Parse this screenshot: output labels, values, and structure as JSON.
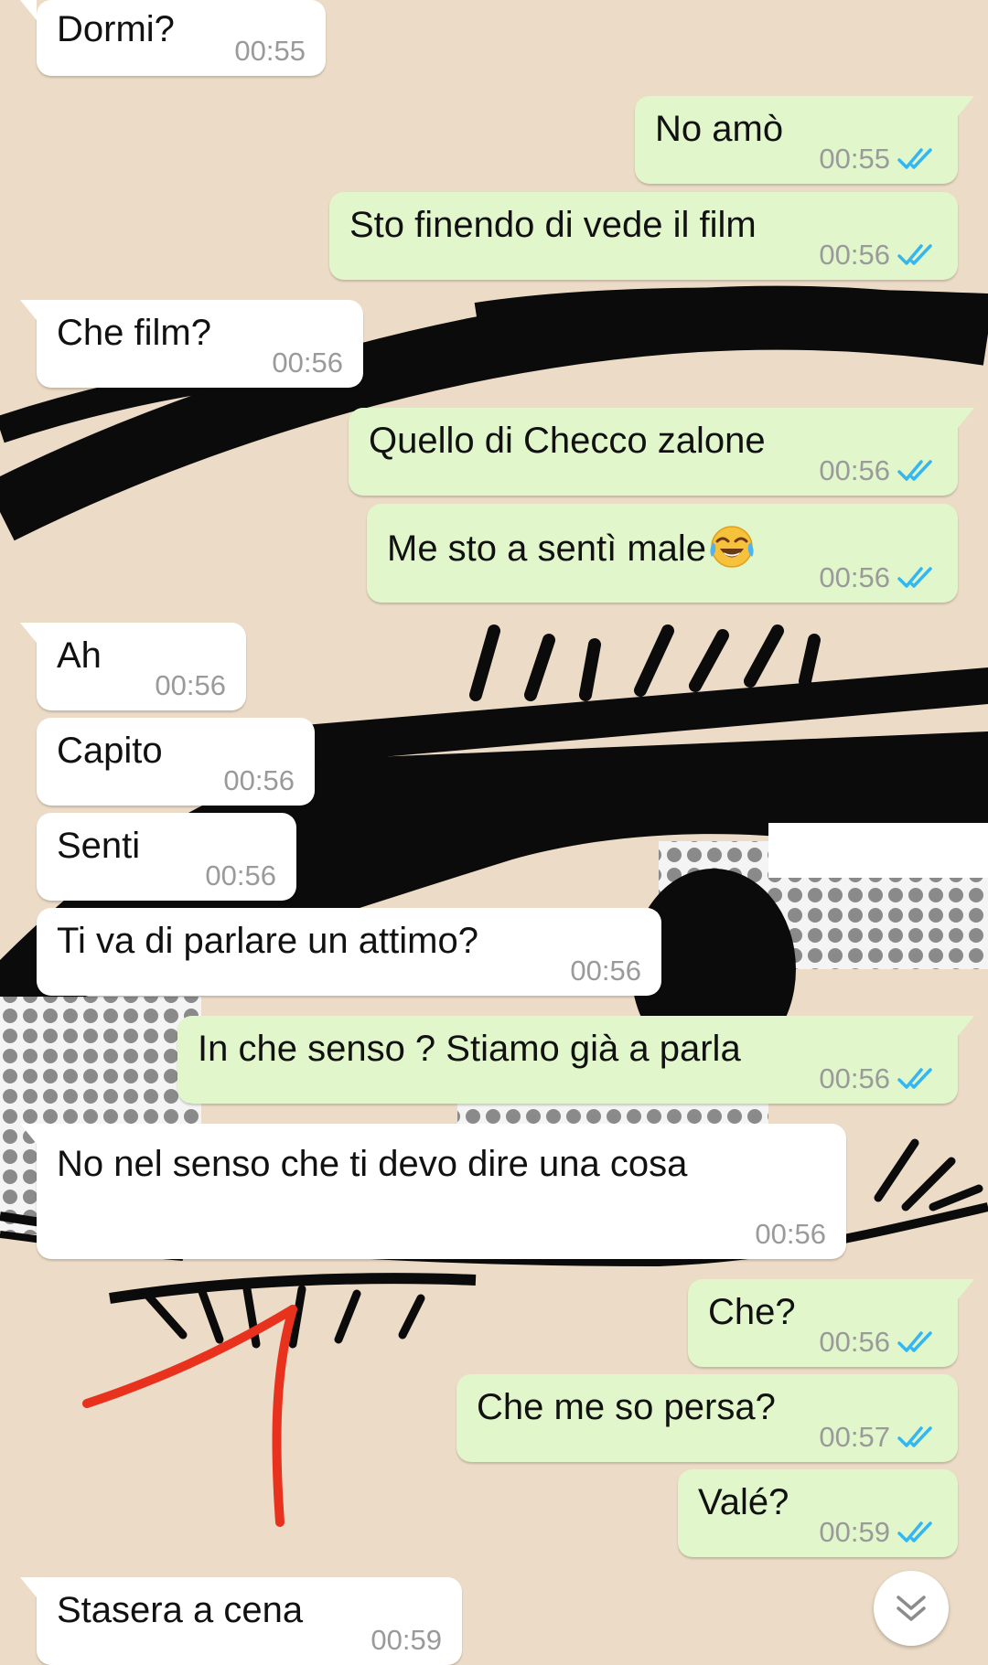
{
  "messages": [
    {
      "side": "in",
      "text": "Dormi?",
      "time": "00:55"
    },
    {
      "side": "out",
      "text": "No amò",
      "time": "00:55",
      "status": "read"
    },
    {
      "side": "out",
      "text": "Sto finendo di vede il film",
      "time": "00:56",
      "status": "read"
    },
    {
      "side": "in",
      "text": "Che film?",
      "time": "00:56"
    },
    {
      "side": "out",
      "text": "Quello di Checco zalone",
      "time": "00:56",
      "status": "read"
    },
    {
      "side": "out",
      "text": "Me sto a sentì male",
      "emoji": "face-with-tears-of-joy",
      "time": "00:56",
      "status": "read"
    },
    {
      "side": "in",
      "text": "Ah",
      "time": "00:56"
    },
    {
      "side": "in",
      "text": "Capito",
      "time": "00:56"
    },
    {
      "side": "in",
      "text": "Senti",
      "time": "00:56"
    },
    {
      "side": "in",
      "text": "Ti va di parlare un attimo?",
      "time": "00:56"
    },
    {
      "side": "out",
      "text": "In che senso ? Stiamo già a parla",
      "time": "00:56",
      "status": "read"
    },
    {
      "side": "in",
      "text": "No nel senso che ti devo dire una cosa",
      "time": "00:56"
    },
    {
      "side": "out",
      "text": "Che?",
      "time": "00:56",
      "status": "read"
    },
    {
      "side": "out",
      "text": "Che me so persa?",
      "time": "00:57",
      "status": "read"
    },
    {
      "side": "out",
      "text": "Valé?",
      "time": "00:59",
      "status": "read"
    },
    {
      "side": "in",
      "text": "Stasera a cena",
      "time": "00:59"
    }
  ],
  "colors": {
    "incoming_bubble": "#ffffff",
    "outgoing_bubble": "#e1f7cb",
    "read_ticks": "#34b7f1",
    "timestamp": "#9a9a9a",
    "wallpaper_bg": "#ecdcc7",
    "annotation_arrow": "#e8321d"
  },
  "icons": {
    "read_receipt": "double-check-icon",
    "scroll_button": "chevron-down-icon",
    "annotation": "red-arrow-annotation"
  }
}
